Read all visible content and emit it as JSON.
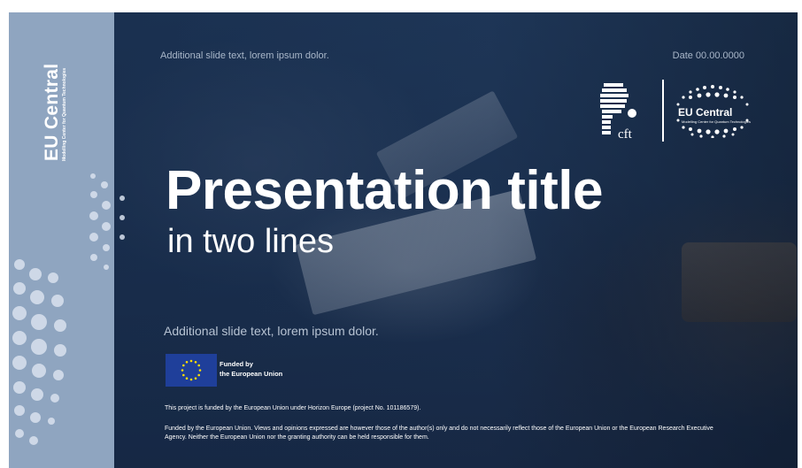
{
  "slide": {
    "brand_title": "EU Central",
    "brand_subtitle": "Modelling Center for Quantum Technologies",
    "top_text": "Additional slide text, lorem ipsum dolor.",
    "date_text": "Date 00.00.0000",
    "title": "Presentation title",
    "subtitle": "in two lines",
    "mid_text": "Additional slide text, lorem ipsum dolor.",
    "funded_line1": "Funded by",
    "funded_line2": "the European Union",
    "disclaimer1": "This project is funded by the European Union under Horizon Europe (project No. 101186579).",
    "disclaimer2": "Funded by the European Union. Views and opinions expressed are however those of the author(s) only and do not necessarily reflect those of the European Union or the European Research Executive Agency. Neither the European Union nor the granting authority can be held responsible for them.",
    "logo_cft_text": "cft",
    "logo_eu_text": "EU Central",
    "logo_eu_sub": "Modelling Center for Quantum Technologies"
  },
  "colors": {
    "side_strip": "#8fa5c0",
    "background": "#1b2d48",
    "eu_blue": "#1f3f9a",
    "eu_star": "#ffdd00"
  },
  "icons": {
    "eu_flag": "eu-flag-icon",
    "cft_logo": "cft-logo-icon",
    "eu_central_logo": "eu-central-logo-icon"
  }
}
